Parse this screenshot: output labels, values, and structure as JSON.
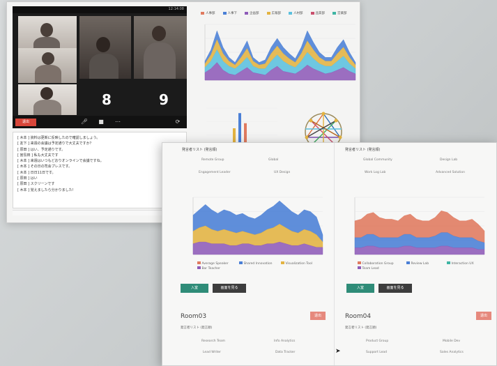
{
  "back_window": {
    "video": {
      "timestamp": "12:14:08",
      "counters": [
        "8",
        "9"
      ],
      "leave_label": "退出"
    },
    "chat": {
      "lines": [
        "[ 木本 ] 資料は更新に反映したので確認しましょう。",
        "[ 友下 ] 来週の会議は予定通りで大丈夫ですか？",
        "[ 原田 ] はい、予定通りです。",
        "[ 宮島田 ] 私も大丈夫です",
        "[ 木本 ] 来週はいつもどおりオンラインで会議ですね。",
        "[ 木本 ] その日の司会プレスです。",
        "[ 木本 ] 日日11日です。",
        "[ 原田 ] はい",
        "[ 原田 ] スクリーンです",
        "[ 木本 ] 覚えましたら分かりました!"
      ]
    },
    "area_legend": [
      {
        "label": "人事部",
        "color": "#e07a5f"
      },
      {
        "label": "人事下",
        "color": "#4a7fd6"
      },
      {
        "label": "企画部",
        "color": "#8e5bb8"
      },
      {
        "label": "広報部",
        "color": "#e3b341"
      },
      {
        "label": "人材部",
        "color": "#5bc0de"
      },
      {
        "label": "品質部",
        "color": "#c94f6d"
      },
      {
        "label": "営業部",
        "color": "#3fb5a4"
      }
    ]
  },
  "front_window": {
    "rooms": [
      {
        "subtitle": "発言者リスト (発言順)",
        "pills": [
          "Remote Group",
          "Global",
          "Engagement Leader",
          "UX Design"
        ],
        "legend": [
          "Average Speaker",
          "Shared Innovation",
          "Visualization Tool",
          "Bar Teacher"
        ],
        "enter_label": "入室",
        "view_label": "画面を見る"
      },
      {
        "subtitle": "発言者リスト (発言順)",
        "pills": [
          "Global Community",
          "Design Lab",
          "Work Log Lab",
          "Advanced Solution"
        ],
        "legend": [
          "Collaboration Group",
          "Review Lab",
          "Interaction UX",
          "Team Lead"
        ],
        "enter_label": "入室",
        "view_label": "画面を見る"
      }
    ],
    "lower_rooms": [
      {
        "name": "Room03",
        "tag": "退出",
        "subtitle": "発言者リスト (発言順)",
        "pills": [
          "Research Team",
          "Info Analytics",
          "Lead Writer",
          "Data Tracker"
        ]
      },
      {
        "name": "Room04",
        "tag": "退出",
        "subtitle": "発言者リスト (発言順)",
        "pills": [
          "Product Group",
          "Mobile Dev",
          "Support Lead",
          "Sales Analytics"
        ]
      }
    ]
  },
  "chart_data": [
    {
      "type": "area",
      "series": [
        {
          "values": [
            6,
            9,
            14,
            8,
            5,
            4,
            7,
            10,
            6,
            5,
            4,
            8,
            11,
            7,
            6,
            5,
            8,
            12,
            9,
            7,
            5,
            6,
            8,
            10,
            7,
            5
          ]
        },
        {
          "values": [
            4,
            6,
            10,
            7,
            6,
            5,
            6,
            8,
            5,
            4,
            5,
            7,
            9,
            8,
            6,
            5,
            7,
            10,
            8,
            6,
            6,
            5,
            7,
            9,
            6,
            4
          ]
        },
        {
          "values": [
            3,
            5,
            8,
            6,
            4,
            3,
            5,
            7,
            4,
            3,
            4,
            6,
            7,
            6,
            5,
            4,
            6,
            9,
            7,
            5,
            4,
            4,
            6,
            7,
            5,
            3
          ]
        },
        {
          "values": [
            2,
            4,
            7,
            5,
            3,
            2,
            4,
            6,
            3,
            2,
            3,
            5,
            6,
            5,
            4,
            3,
            5,
            8,
            6,
            4,
            3,
            3,
            5,
            6,
            4,
            2
          ]
        }
      ]
    },
    {
      "type": "bar",
      "series": [
        {
          "values": [
            8,
            14,
            10
          ]
        }
      ]
    },
    {
      "type": "area",
      "series": [
        {
          "values": [
            6,
            7,
            7,
            6,
            6,
            6,
            5,
            5,
            6,
            6,
            5,
            5,
            6,
            6,
            7,
            6,
            5,
            5,
            6,
            5,
            4,
            4
          ]
        },
        {
          "values": [
            7,
            8,
            9,
            8,
            7,
            8,
            8,
            7,
            7,
            6,
            6,
            7,
            8,
            9,
            10,
            9,
            8,
            7,
            8,
            8,
            7,
            3
          ]
        },
        {
          "values": [
            9,
            10,
            12,
            11,
            10,
            11,
            11,
            10,
            10,
            9,
            9,
            10,
            11,
            12,
            13,
            12,
            11,
            10,
            11,
            11,
            10,
            4
          ]
        }
      ]
    },
    {
      "type": "area",
      "series": [
        {
          "values": [
            4,
            4,
            5,
            5,
            4,
            4,
            4,
            4,
            5,
            5,
            4,
            4,
            4,
            4,
            5,
            5,
            4,
            4,
            4,
            4,
            3,
            3
          ]
        },
        {
          "values": [
            6,
            6,
            7,
            7,
            6,
            6,
            6,
            6,
            7,
            7,
            6,
            6,
            6,
            7,
            8,
            8,
            7,
            6,
            6,
            6,
            5,
            4
          ]
        },
        {
          "values": [
            10,
            11,
            12,
            13,
            12,
            11,
            11,
            10,
            11,
            12,
            11,
            10,
            10,
            11,
            13,
            12,
            11,
            10,
            10,
            11,
            10,
            7
          ]
        }
      ]
    }
  ]
}
